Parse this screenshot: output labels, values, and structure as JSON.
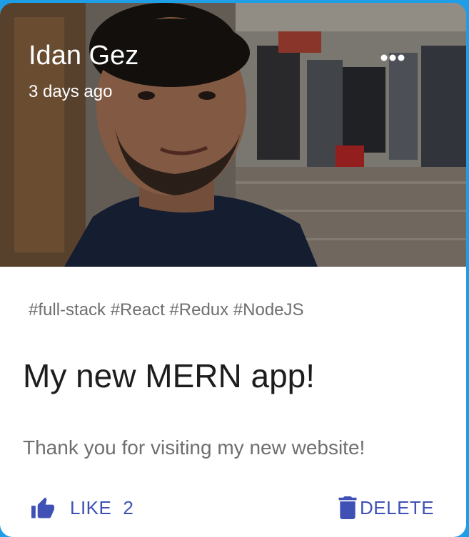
{
  "post": {
    "author": "Idan Gez",
    "created": "3 days ago",
    "tags": "#full-stack #React #Redux #NodeJS",
    "title": "My new MERN app!",
    "message": "Thank you for visiting my new website!",
    "like_label": "LIKE",
    "like_count": "2",
    "delete_label": "DELETE"
  },
  "icons": {
    "more": "more-horiz-icon",
    "like": "thumb-up-icon",
    "delete": "trash-icon"
  },
  "colors": {
    "accent": "#3f51b5",
    "frame": "#1f9ee8",
    "card": "#ffffff"
  }
}
